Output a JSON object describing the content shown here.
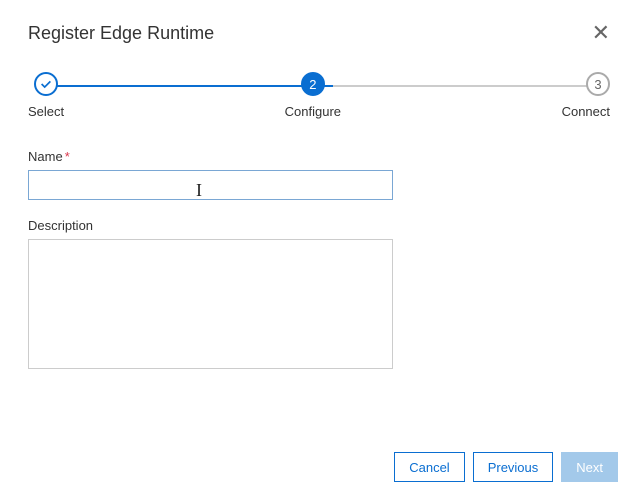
{
  "header": {
    "title": "Register Edge Runtime"
  },
  "stepper": {
    "steps": [
      {
        "label": "Select",
        "num": "1",
        "state": "done"
      },
      {
        "label": "Configure",
        "num": "2",
        "state": "active"
      },
      {
        "label": "Connect",
        "num": "3",
        "state": "pending"
      }
    ]
  },
  "form": {
    "name_label": "Name",
    "name_value": "",
    "description_label": "Description",
    "description_value": ""
  },
  "buttons": {
    "cancel": "Cancel",
    "previous": "Previous",
    "next": "Next"
  }
}
